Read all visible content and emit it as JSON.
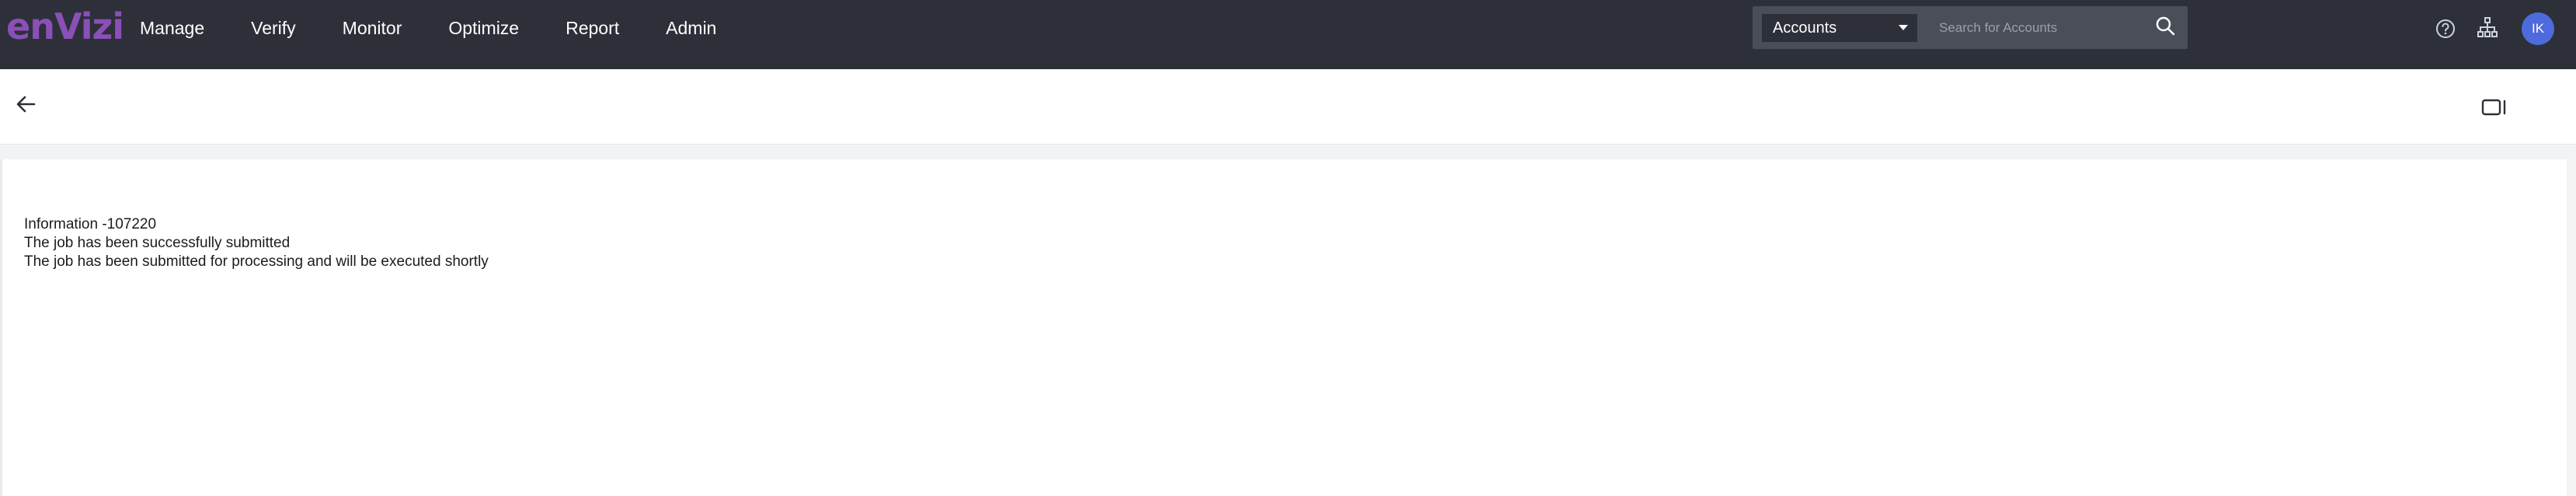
{
  "app": {
    "logo_text": "enVizi",
    "colors": {
      "topbar": "#2d3039",
      "logo": "#8b4fb8",
      "avatar": "#4d6bdc"
    }
  },
  "nav": {
    "items": [
      {
        "label": "Manage"
      },
      {
        "label": "Verify"
      },
      {
        "label": "Monitor"
      },
      {
        "label": "Optimize"
      },
      {
        "label": "Report"
      },
      {
        "label": "Admin"
      }
    ]
  },
  "search": {
    "scope_value": "Accounts",
    "placeholder": "Search for Accounts",
    "icon": "search-icon"
  },
  "header_icons": {
    "help": "help-icon",
    "hierarchy": "hierarchy-icon",
    "avatar_initials": "IK"
  },
  "subheader": {
    "back": "back-arrow-icon",
    "panel": "panel-toggle-icon"
  },
  "message": {
    "title": "Information -107220",
    "line1": "The job has been successfully submitted",
    "line2": "The job has been submitted for processing and will be executed shortly"
  }
}
